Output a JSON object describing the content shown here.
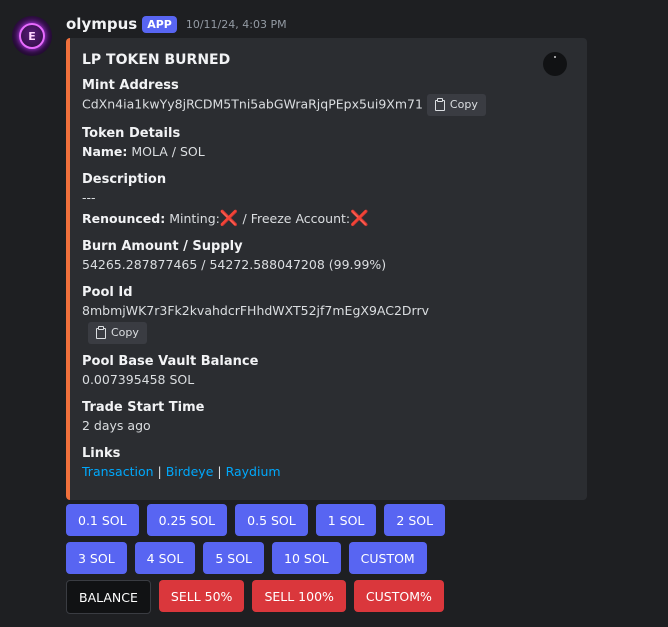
{
  "author": {
    "name": "olympus",
    "badge": "APP",
    "timestamp": "10/11/24, 4:03 PM"
  },
  "embed": {
    "title": "LP TOKEN BURNED",
    "mint_address": {
      "label": "Mint Address",
      "value": "CdXn4ia1kwYy8jRCDM5Tni5abGWraRjqPEpx5ui9Xm71",
      "copy_label": "Copy"
    },
    "token_details": {
      "label": "Token Details",
      "name_label": "Name:",
      "name_value": "MOLA / SOL"
    },
    "description": {
      "label": "Description",
      "value": "---",
      "renounced_label": "Renounced:",
      "minting_label": "Minting:",
      "freeze_label": "/ Freeze Account:",
      "x_mark": "❌"
    },
    "burn": {
      "label": "Burn Amount / Supply",
      "value": "54265.287877465 / 54272.588047208 (99.99%)"
    },
    "pool_id": {
      "label": "Pool Id",
      "value": "8mbmjWK7r3Fk2kvahdcrFHhdWXT52jf7mEgX9AC2Drrv",
      "copy_label": "Copy"
    },
    "pool_balance": {
      "label": "Pool Base Vault Balance",
      "value": "0.007395458 SOL"
    },
    "trade_start": {
      "label": "Trade Start Time",
      "value": "2 days ago"
    },
    "links": {
      "label": "Links",
      "items": [
        "Transaction",
        "Birdeye",
        "Raydium"
      ],
      "separator": "|"
    }
  },
  "buttons": {
    "row1": [
      "0.1 SOL",
      "0.25 SOL",
      "0.5 SOL",
      "1 SOL",
      "2 SOL"
    ],
    "row2": [
      "3 SOL",
      "4 SOL",
      "5 SOL",
      "10 SOL",
      "CUSTOM"
    ],
    "row3": [
      "BALANCE",
      "SELL 50%",
      "SELL 100%",
      "CUSTOM%"
    ]
  },
  "colors": {
    "embed_accent": "#f0703c",
    "button_primary": "#5865f2",
    "button_danger": "#da373c",
    "link": "#00a8fc"
  }
}
